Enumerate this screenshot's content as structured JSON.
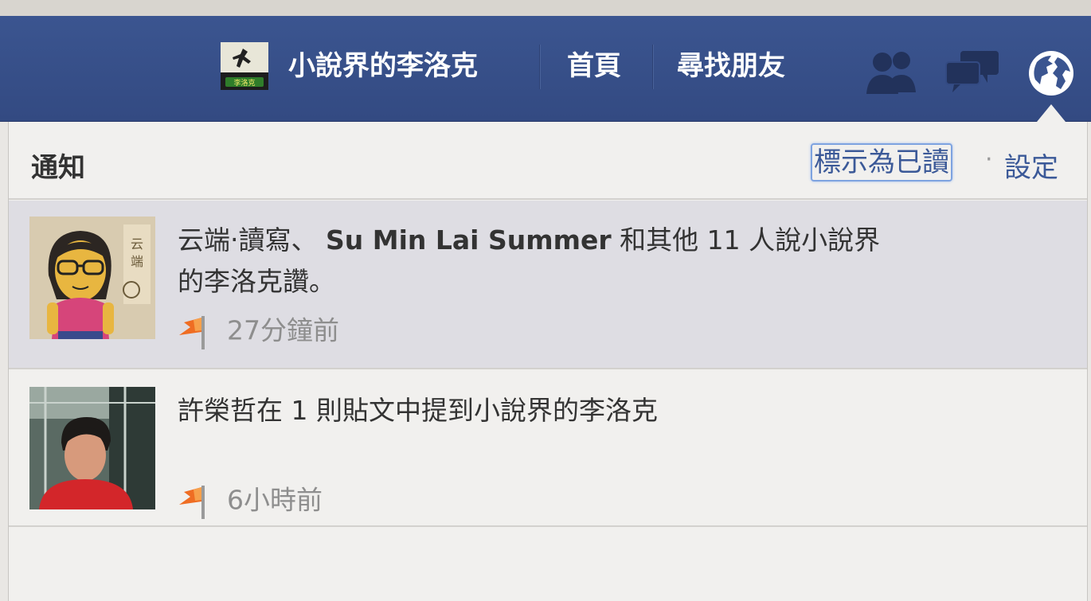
{
  "topbar": {
    "profile_name": "小說界的李洛克",
    "home": "首頁",
    "find_friends": "尋找朋友",
    "profile_thumb_text": "李洛克"
  },
  "notifications": {
    "title": "通知",
    "mark_read": "標示為已讀",
    "separator": "·",
    "settings": "設定",
    "items": [
      {
        "actor1": "云端‧讀寫、",
        "actor2": "Su Min Lai Summer",
        "rest_line1": "和其他 11 人說小說界",
        "rest_line2": "的李洛克讚。",
        "time": "27分鐘前",
        "unread": true
      },
      {
        "text": "許榮哲在 1 則貼文中提到小說界的李洛克",
        "time": "6小時前",
        "unread": false
      }
    ]
  },
  "colors": {
    "topbar": "#3b5590",
    "link": "#3b5998",
    "unread_bg": "#dedde3",
    "flag": "#ef6d23"
  },
  "icons": {
    "friend_requests": "friends-icon",
    "messages": "messages-icon",
    "notifications": "globe-icon",
    "notif_type": "flag-icon"
  }
}
